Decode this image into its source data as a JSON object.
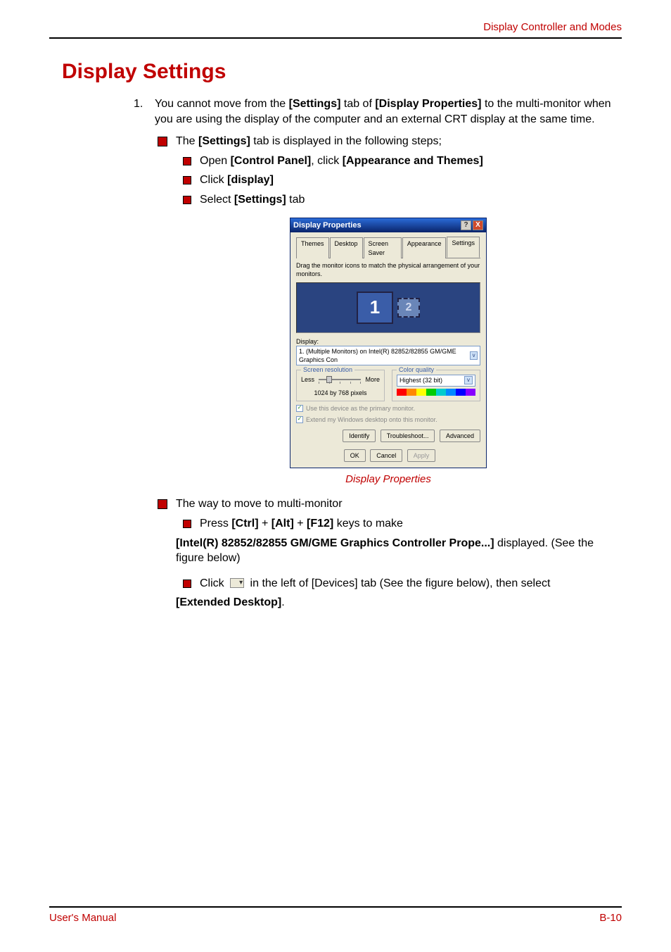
{
  "header": {
    "right": "Display Controller and Modes"
  },
  "section": {
    "title": "Display Settings"
  },
  "body": {
    "p1_pre": "You cannot move from the ",
    "p1_b1": "[Settings]",
    "p1_mid": " tab of ",
    "p1_b2": "[Display Properties]",
    "p1_post": " to the multi-monitor when you are using the display of the computer and an external CRT display at the same time.",
    "p2_pre": "The ",
    "p2_b": "[Settings]",
    "p2_post": " tab is displayed in the following steps;",
    "s1_pre": "Open ",
    "s1_b1": "[Control Panel]",
    "s1_mid": ", click ",
    "s1_b2": "[Appearance and Themes]",
    "s2_pre": "Click ",
    "s2_b": "[display]",
    "s3_pre": "Select ",
    "s3_b": "[Settings]",
    "s3_post": " tab",
    "caption": "Display Properties",
    "p3": "The way to move to multi-monitor",
    "p4_pre": "Press ",
    "p4_b1": "[Ctrl]",
    "p4_plus1": " + ",
    "p4_b2": "[Alt]",
    "p4_plus2": " + ",
    "p4_b3": "[F12]",
    "p4_post": " keys to make",
    "p5_b": "[Intel(R) 82852/82855 GM/GME Graphics Controller Prope...]",
    "p5_post": " displayed. (See the figure below)",
    "p6_pre": "Click ",
    "p6_post": " in the left of [Devices] tab (See the figure below), then select",
    "p7_b": "[Extended Desktop]",
    "p7_post": "."
  },
  "dialog": {
    "title": "Display Properties",
    "help": "?",
    "close": "X",
    "tabs": [
      "Themes",
      "Desktop",
      "Screen Saver",
      "Appearance",
      "Settings"
    ],
    "instruction": "Drag the monitor icons to match the physical arrangement of your monitors.",
    "mon1": "1",
    "mon2": "2",
    "display_label": "Display:",
    "display_value": "1. (Multiple Monitors) on Intel(R) 82852/82855 GM/GME Graphics Con",
    "res_group": "Screen resolution",
    "res_less": "Less",
    "res_more": "More",
    "res_value": "1024 by 768 pixels",
    "color_group": "Color quality",
    "color_value": "Highest (32 bit)",
    "chk1": "Use this device as the primary monitor.",
    "chk2": "Extend my Windows desktop onto this monitor.",
    "btn_identify": "Identify",
    "btn_trouble": "Troubleshoot...",
    "btn_adv": "Advanced",
    "btn_ok": "OK",
    "btn_cancel": "Cancel",
    "btn_apply": "Apply"
  },
  "footer": {
    "left": "User's Manual",
    "right": "B-10"
  }
}
